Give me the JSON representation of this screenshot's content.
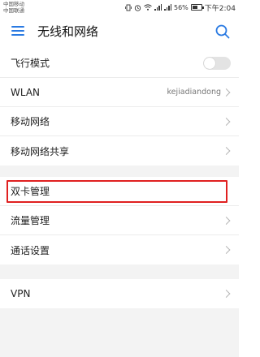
{
  "status_bar": {
    "carriers": [
      "中国移动",
      "中国联通"
    ],
    "battery_percent": "56%",
    "time": "下午2:04"
  },
  "header": {
    "title": "无线和网络"
  },
  "groups": [
    {
      "items": [
        {
          "label": "飞行模式",
          "type": "toggle",
          "on": false
        },
        {
          "label": "WLAN",
          "value": "kejiadiandong"
        },
        {
          "label": "移动网络"
        },
        {
          "label": "移动网络共享"
        }
      ]
    },
    {
      "items": [
        {
          "label": "双卡管理",
          "highlighted": true
        },
        {
          "label": "流量管理"
        },
        {
          "label": "通话设置"
        }
      ]
    },
    {
      "items": [
        {
          "label": "VPN"
        }
      ]
    }
  ],
  "colors": {
    "accent": "#2a7ae2",
    "highlight_border": "#e02020",
    "section_gap": "#f3f3f3"
  }
}
